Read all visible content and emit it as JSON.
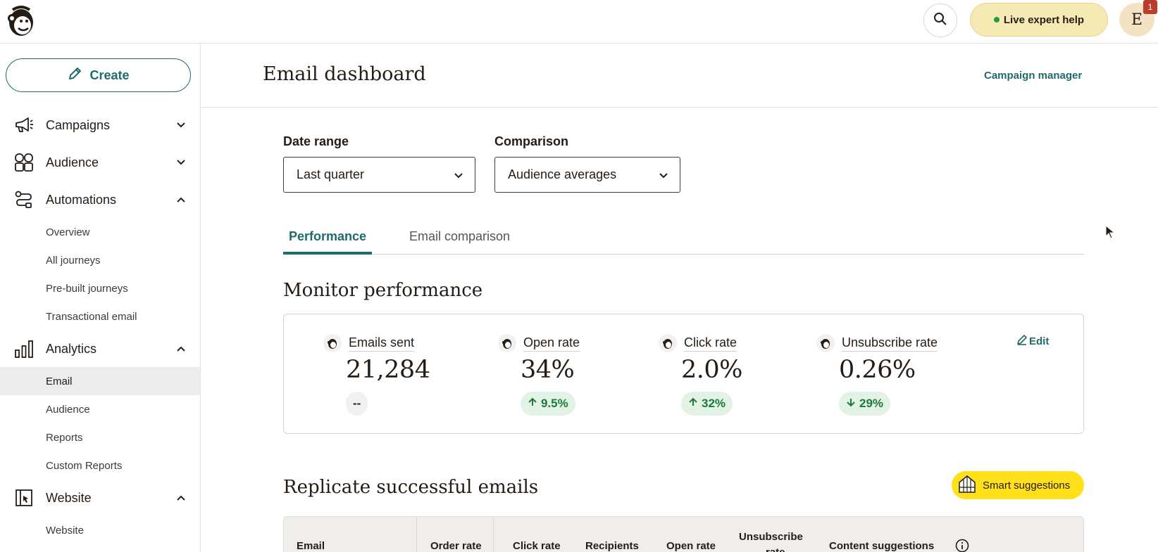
{
  "topbar": {
    "help_label": "Live expert help",
    "avatar_initial": "E",
    "notification_count": "1"
  },
  "sidebar": {
    "create_label": "Create",
    "items": [
      {
        "label": "Campaigns",
        "icon": "megaphone-icon",
        "expanded": false
      },
      {
        "label": "Audience",
        "icon": "audience-icon",
        "expanded": false
      },
      {
        "label": "Automations",
        "icon": "automations-icon",
        "expanded": true
      },
      {
        "label": "Analytics",
        "icon": "bar-chart-icon",
        "expanded": true
      },
      {
        "label": "Website",
        "icon": "website-icon",
        "expanded": true
      }
    ],
    "automations_sub": [
      "Overview",
      "All journeys",
      "Pre-built journeys",
      "Transactional email"
    ],
    "analytics_sub": [
      "Email",
      "Audience",
      "Reports",
      "Custom Reports"
    ],
    "website_sub": [
      "Website"
    ],
    "active_sub": "Email"
  },
  "header": {
    "title": "Email dashboard",
    "campaign_manager": "Campaign manager"
  },
  "filters": {
    "date_range_label": "Date range",
    "date_range_value": "Last quarter",
    "comparison_label": "Comparison",
    "comparison_value": "Audience averages"
  },
  "tabs": [
    {
      "label": "Performance",
      "active": true
    },
    {
      "label": "Email comparison",
      "active": false
    }
  ],
  "performance": {
    "title": "Monitor performance",
    "edit_label": "Edit",
    "metrics": [
      {
        "label": "Emails sent",
        "value": "21,284",
        "delta": "--",
        "direction": "neutral"
      },
      {
        "label": "Open rate",
        "value": "34%",
        "delta": "9.5%",
        "direction": "up"
      },
      {
        "label": "Click rate",
        "value": "2.0%",
        "delta": "32%",
        "direction": "up"
      },
      {
        "label": "Unsubscribe rate",
        "value": "0.26%",
        "delta": "29%",
        "direction": "down"
      }
    ]
  },
  "replicate": {
    "title": "Replicate successful emails",
    "smart_suggestions": "Smart suggestions",
    "columns": [
      "Email",
      "Order rate",
      "Click rate",
      "Recipients",
      "Open rate",
      "Unsubscribe",
      "rate",
      "Content suggestions"
    ]
  },
  "colors": {
    "brand_teal": "#1f6a6a",
    "help_bg": "#f5e9b4",
    "smart_yellow": "#ffe01b",
    "positive_green": "#1c7a3a"
  }
}
